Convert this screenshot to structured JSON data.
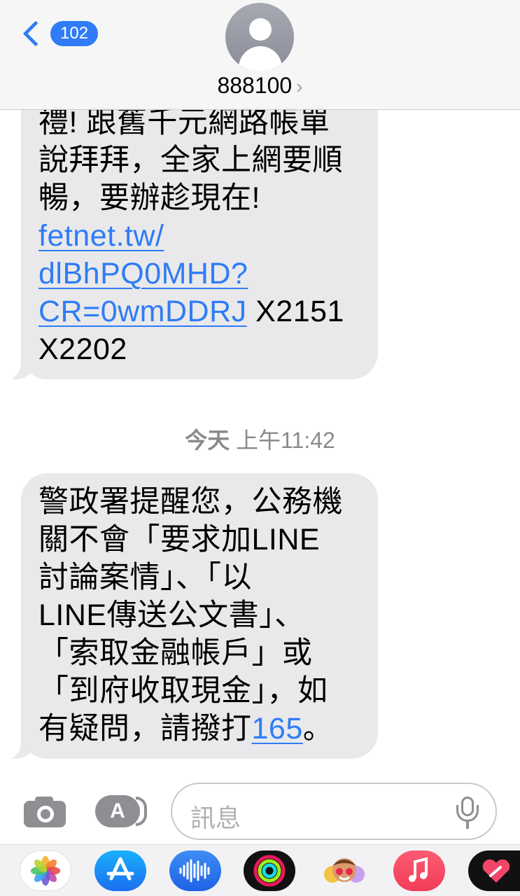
{
  "header": {
    "back_count": "102",
    "contact_name": "888100",
    "contact_chevron": "›"
  },
  "messages": {
    "first": {
      "lines": [
        "禮! 跟舊千元網路帳單",
        "說拜拜，全家上網要順",
        "暢，要辦趁現在!"
      ],
      "link_lines": [
        "fetnet.tw/",
        "dlBhPQ0MHD?",
        "CR=0wmDDRJ"
      ],
      "after_link": " X2151",
      "last_line": "X2202"
    },
    "timestamp": {
      "day": "今天",
      "time": "上午11:42"
    },
    "second": {
      "lines": [
        "警政署提醒您，公務機",
        "關不會「要求加LINE",
        "討論案情」、「以",
        "LINE傳送公文書」、",
        "「索取金融帳戶」或",
        "「到府收取現金」，如"
      ],
      "last_prefix": "有疑問，請撥打",
      "phone_link": "165",
      "last_suffix": "。"
    }
  },
  "input": {
    "placeholder": "訊息",
    "apps_glyph": "A"
  },
  "drawer": {
    "apps": [
      "photos-app-icon",
      "app-store-icon",
      "audio-message-icon",
      "activity-icon",
      "memoji-stickers-icon",
      "music-icon",
      "digital-touch-icon"
    ]
  },
  "colors": {
    "accent": "#2f7cf6",
    "bubble": "#e9e9eb",
    "gray_icon": "#8e8e93"
  }
}
